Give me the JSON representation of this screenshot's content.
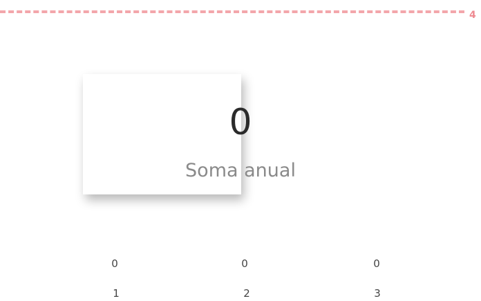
{
  "reference": {
    "label": "4",
    "color": "#ee8a91"
  },
  "kpi": {
    "value": "0",
    "label": "Soma anual"
  },
  "values": [
    "0",
    "0",
    "0"
  ],
  "labels": [
    "1",
    "2",
    "3"
  ]
}
